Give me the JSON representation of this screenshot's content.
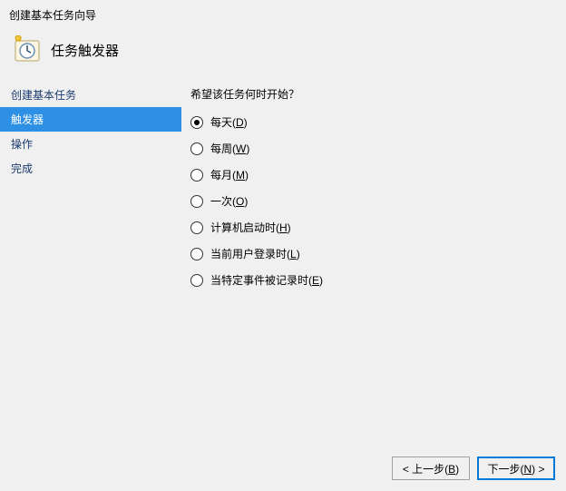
{
  "window_title": "创建基本任务向导",
  "page_title": "任务触发器",
  "sidebar": {
    "items": [
      {
        "label": "创建基本任务",
        "selected": false
      },
      {
        "label": "触发器",
        "selected": true
      },
      {
        "label": "操作",
        "selected": false
      },
      {
        "label": "完成",
        "selected": false
      }
    ]
  },
  "content": {
    "question": "希望该任务何时开始？",
    "options": [
      {
        "text": "每天",
        "hotkey": "D",
        "checked": true
      },
      {
        "text": "每周",
        "hotkey": "W",
        "checked": false
      },
      {
        "text": "每月",
        "hotkey": "M",
        "checked": false
      },
      {
        "text": "一次",
        "hotkey": "O",
        "checked": false
      },
      {
        "text": "计算机启动时",
        "hotkey": "H",
        "checked": false
      },
      {
        "text": "当前用户登录时",
        "hotkey": "L",
        "checked": false
      },
      {
        "text": "当特定事件被记录时",
        "hotkey": "E",
        "checked": false
      }
    ]
  },
  "footer": {
    "back_prefix": "< 上一步(",
    "back_hotkey": "B",
    "back_suffix": ")",
    "next_prefix": "下一步(",
    "next_hotkey": "N",
    "next_suffix": ") >"
  }
}
